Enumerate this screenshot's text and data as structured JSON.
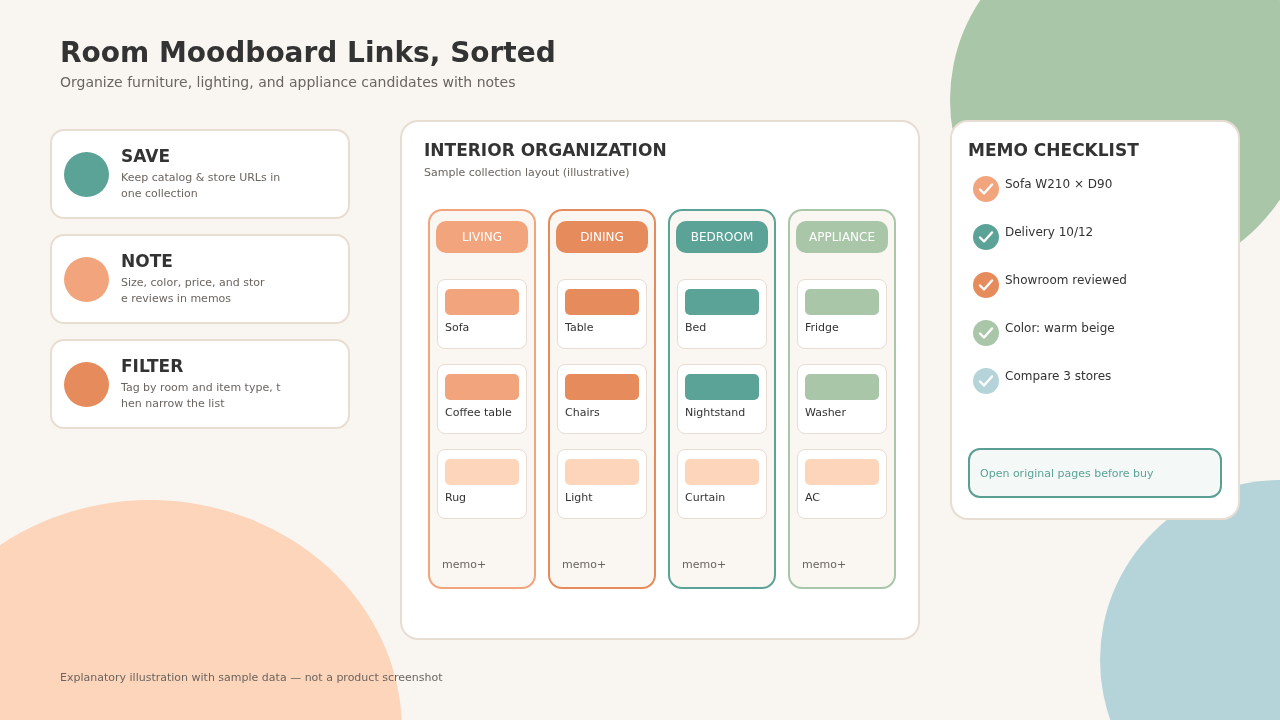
{
  "title": "Room Moodboard Links, Sorted",
  "subtitle": "Organize furniture, lighting, and appliance candidates with notes",
  "features": [
    {
      "title": "SAVE",
      "text": "Keep catalog & store URLs in\none collection",
      "color": "#5ba396"
    },
    {
      "title": "NOTE",
      "text": "Size, color, price, and stor\ne reviews in memos",
      "color": "#f2a57d"
    },
    {
      "title": "FILTER",
      "text": "Tag by room and item type, t\nhen narrow the list",
      "color": "#e68c5c"
    }
  ],
  "board": {
    "title": "INTERIOR ORGANIZATION",
    "subtitle": "Sample collection layout (illustrative)",
    "columns": [
      {
        "label": "LIVING",
        "color": "#f2a57d",
        "items": [
          {
            "name": "Sofa",
            "color": "#f2a57d"
          },
          {
            "name": "Coffee table",
            "color": "#f2a57d"
          },
          {
            "name": "Rug",
            "color": "#fdd5bb"
          }
        ],
        "memo": "memo+"
      },
      {
        "label": "DINING",
        "color": "#e68c5c",
        "items": [
          {
            "name": "Table",
            "color": "#e68c5c"
          },
          {
            "name": "Chairs",
            "color": "#e68c5c"
          },
          {
            "name": "Light",
            "color": "#fdd5bb"
          }
        ],
        "memo": "memo+"
      },
      {
        "label": "BEDROOM",
        "color": "#5ba396",
        "items": [
          {
            "name": "Bed",
            "color": "#5ba396"
          },
          {
            "name": "Nightstand",
            "color": "#5ba396"
          },
          {
            "name": "Curtain",
            "color": "#fdd5bb"
          }
        ],
        "memo": "memo+"
      },
      {
        "label": "APPLIANCE",
        "color": "#a9c6a9",
        "items": [
          {
            "name": "Fridge",
            "color": "#a9c6a9"
          },
          {
            "name": "Washer",
            "color": "#a9c6a9"
          },
          {
            "name": "AC",
            "color": "#fdd5bb"
          }
        ],
        "memo": "memo+"
      }
    ]
  },
  "checklist": {
    "title": "MEMO CHECKLIST",
    "items": [
      {
        "text": "Sofa W210 × D90",
        "checked": true,
        "color": "#f2a57d"
      },
      {
        "text": "Delivery 10/12",
        "checked": true,
        "color": "#5ba396"
      },
      {
        "text": "Showroom reviewed",
        "checked": true,
        "color": "#e68c5c"
      },
      {
        "text": "Color: warm beige",
        "checked": true,
        "color": "#a9c6a9"
      },
      {
        "text": "Compare 3 stores",
        "checked": true,
        "color": "#b5d4da"
      }
    ],
    "note": "Open original pages before buy"
  },
  "footer": "Explanatory illustration with sample data — not a product screenshot"
}
